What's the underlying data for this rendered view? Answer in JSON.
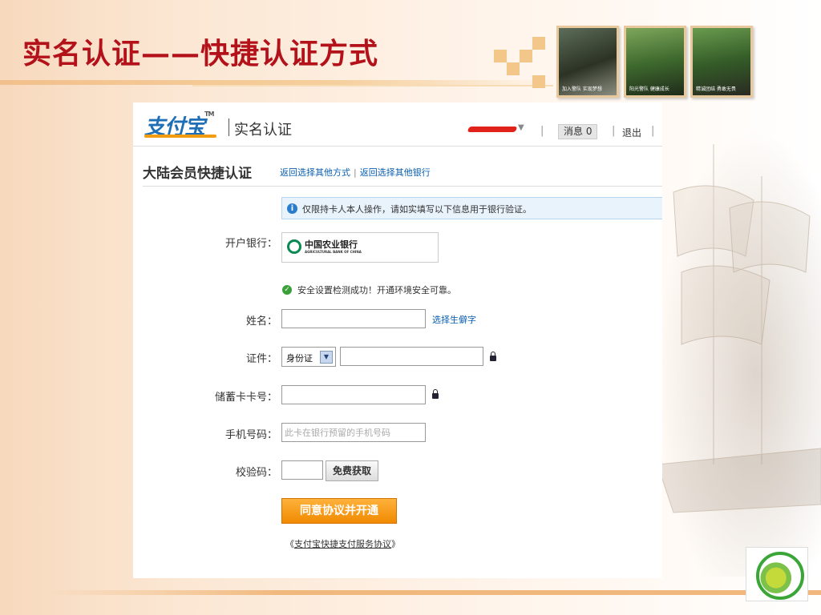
{
  "slide": {
    "title": "实名认证——快捷认证方式",
    "photo_captions": [
      "加入警队 实现梦想",
      "阳光警队 健康成长",
      "精诚团结 勇敢无畏"
    ]
  },
  "alipay": {
    "logo_text": "支付宝",
    "logo_tm": "TM",
    "page_title": "实名认证",
    "nav": {
      "messages_label": "消息 0",
      "logout_label": "退出"
    },
    "section_title": "大陆会员快捷认证",
    "links": [
      "返回选择其他方式",
      "返回选择其他银行"
    ],
    "notice": "仅限持卡人本人操作，请如实填写以下信息用于银行验证。",
    "form": {
      "bank_label": "开户银行：",
      "bank_name_cn": "中国农业银行",
      "bank_name_en": "AGRICULTURAL BANK OF CHINA",
      "security_ok": "安全设置检测成功！开通环境安全可靠。",
      "name_label": "姓名：",
      "rare_char_link": "选择生僻字",
      "id_label": "证件：",
      "id_type": "身份证",
      "card_label": "储蓄卡卡号：",
      "phone_label": "手机号码：",
      "phone_placeholder": "此卡在银行预留的手机号码",
      "code_label": "校验码：",
      "get_code_button": "免费获取",
      "submit_button": "同意协议并开通",
      "agreement_prefix": "《",
      "agreement_link": "支付宝快捷支付服务协议",
      "agreement_suffix": "》"
    }
  },
  "colors": {
    "title_red": "#b3121a",
    "link_blue": "#0a5fb0",
    "button_orange": "#f08a00"
  }
}
